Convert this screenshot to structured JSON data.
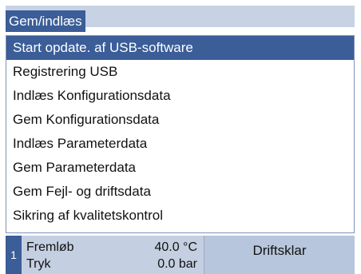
{
  "header": {
    "title": "Gem/indlæs"
  },
  "menu": {
    "items": [
      {
        "label": "Start opdate. af USB-software",
        "selected": true
      },
      {
        "label": "Registrering USB",
        "selected": false
      },
      {
        "label": "Indlæs Konfigurationsdata",
        "selected": false
      },
      {
        "label": "Gem Konfigurationsdata",
        "selected": false
      },
      {
        "label": "Indlæs Parameterdata",
        "selected": false
      },
      {
        "label": "Gem Parameterdata",
        "selected": false
      },
      {
        "label": "Gem Fejl- og driftsdata",
        "selected": false
      },
      {
        "label": "Sikring af kvalitetskontrol",
        "selected": false
      }
    ]
  },
  "status": {
    "zone": "1",
    "flow_label": "Fremløb",
    "flow_value": "40.0 °C",
    "pressure_label": "Tryk",
    "pressure_value": "0.0 bar",
    "state": "Driftsklar"
  },
  "colors": {
    "selected_bg": "#3b5d98",
    "title_bar": "#c7d3e4",
    "status_bar": "#c4d0e1"
  }
}
